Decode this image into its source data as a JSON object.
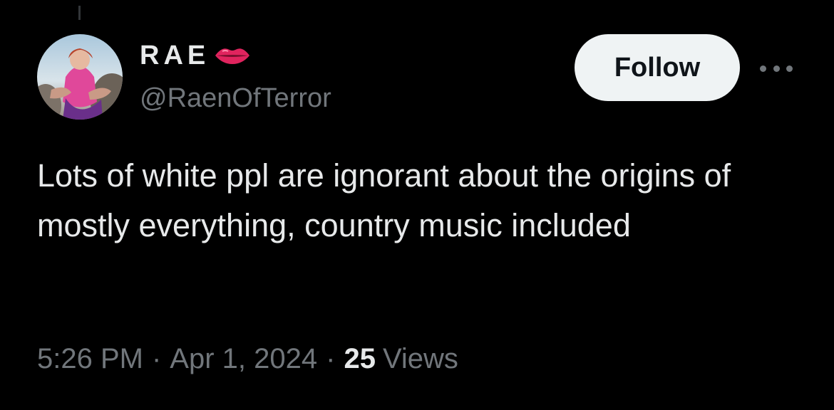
{
  "author": {
    "display_name": "RAE",
    "handle": "@RaenOfTerror",
    "name_emoji": "kiss-mark-icon"
  },
  "actions": {
    "follow_label": "Follow",
    "more_icon": "more-horizontal-icon"
  },
  "tweet": {
    "text": "Lots of white ppl are ignorant about the origins of mostly everything, country music included"
  },
  "meta": {
    "time": "5:26 PM",
    "separator": "·",
    "date": "Apr 1, 2024",
    "views_count": "25",
    "views_label": "Views"
  },
  "colors": {
    "background": "#000000",
    "primary_text": "#e7e9ea",
    "secondary_text": "#71767b",
    "follow_bg": "#eff3f4",
    "follow_text": "#0f1419",
    "lips_red": "#e0245e"
  }
}
